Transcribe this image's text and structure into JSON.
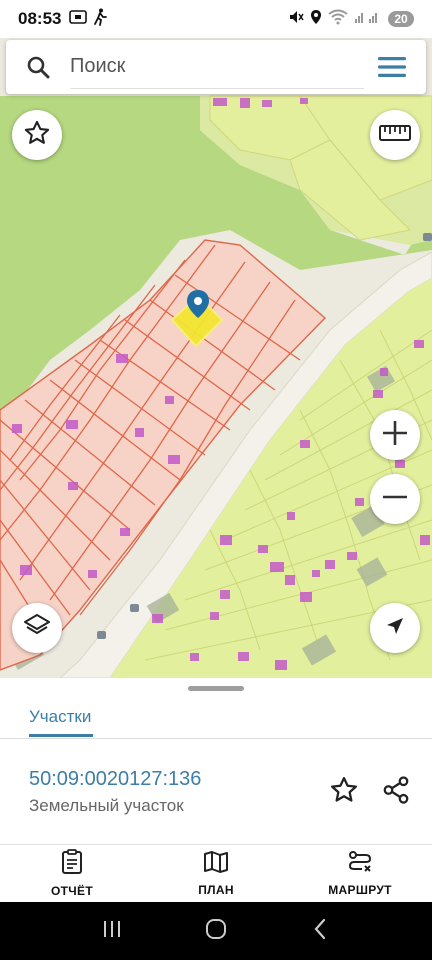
{
  "status_bar": {
    "time": "08:53",
    "battery": "20",
    "icons": [
      "screenshot-icon",
      "walk-icon",
      "mute-icon",
      "location-icon",
      "wifi-icon",
      "signal-icon"
    ]
  },
  "search": {
    "placeholder": "Поиск"
  },
  "sheet": {
    "tab_label": "Участки",
    "cadastral_number": "50:09:0020127:136",
    "parcel_type": "Земельный участок"
  },
  "bottom_nav": {
    "items": [
      {
        "label": "ОТЧЁТ",
        "icon": "report-icon"
      },
      {
        "label": "ПЛАН",
        "icon": "map-plan-icon"
      },
      {
        "label": "МАРШРУТ",
        "icon": "route-icon"
      }
    ]
  },
  "colors": {
    "accent": "#3d7ea6",
    "parcel_fill": "#f6d3c8",
    "parcel_stroke": "#e26a4c",
    "forest": "#b4d882",
    "field": "#e2ef9c",
    "selected": "#f5e62a",
    "building": "#c35ac8"
  }
}
